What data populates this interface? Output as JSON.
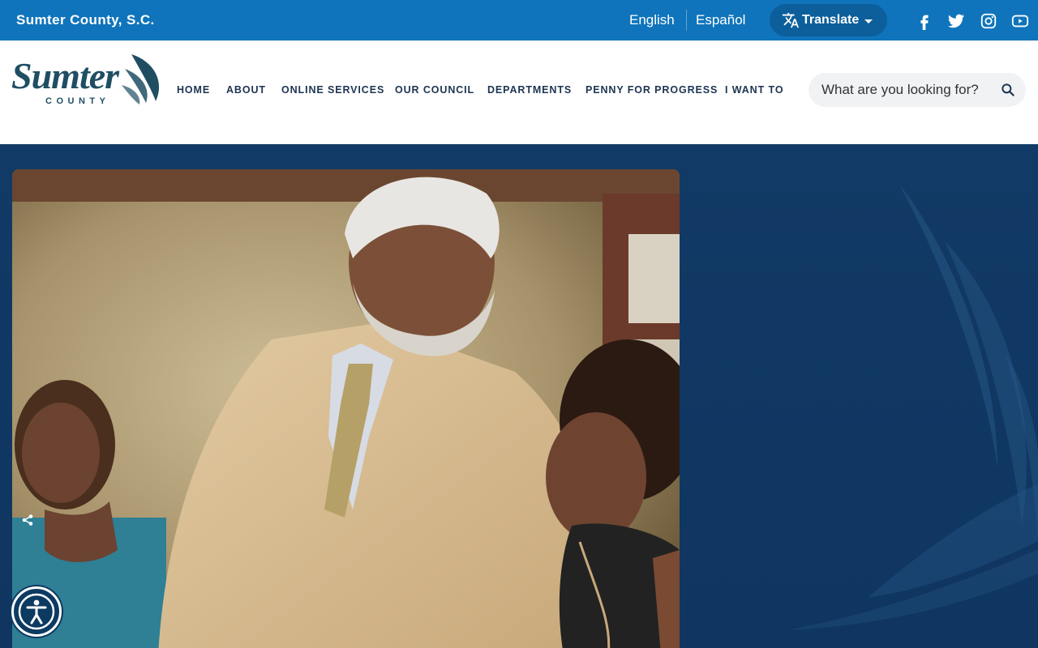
{
  "topbar": {
    "site_name": "Sumter County, S.C.",
    "lang_english": "English",
    "lang_spanish": "Español",
    "translate_label": "Translate",
    "social": [
      "facebook-icon",
      "twitter-icon",
      "instagram-icon",
      "youtube-icon"
    ]
  },
  "logo": {
    "word": "Sumter",
    "sub": "COUNTY"
  },
  "nav": {
    "items": [
      "HOME",
      "ABOUT",
      "ONLINE SERVICES",
      "OUR COUNCIL",
      "DEPARTMENTS",
      "PENNY FOR PROGRESS",
      "I WANT TO"
    ]
  },
  "search": {
    "placeholder": "What are you looking for?"
  },
  "colors": {
    "topbar": "#0f74bb",
    "translate_button": "#0c5f9b",
    "nav_text": "#1d3452",
    "hero_background": "#123a66",
    "logo": "#1f4e63"
  },
  "icons": {
    "translate": "translate-icon",
    "search": "search-icon",
    "share": "share-icon",
    "accessibility": "accessibility-icon"
  }
}
